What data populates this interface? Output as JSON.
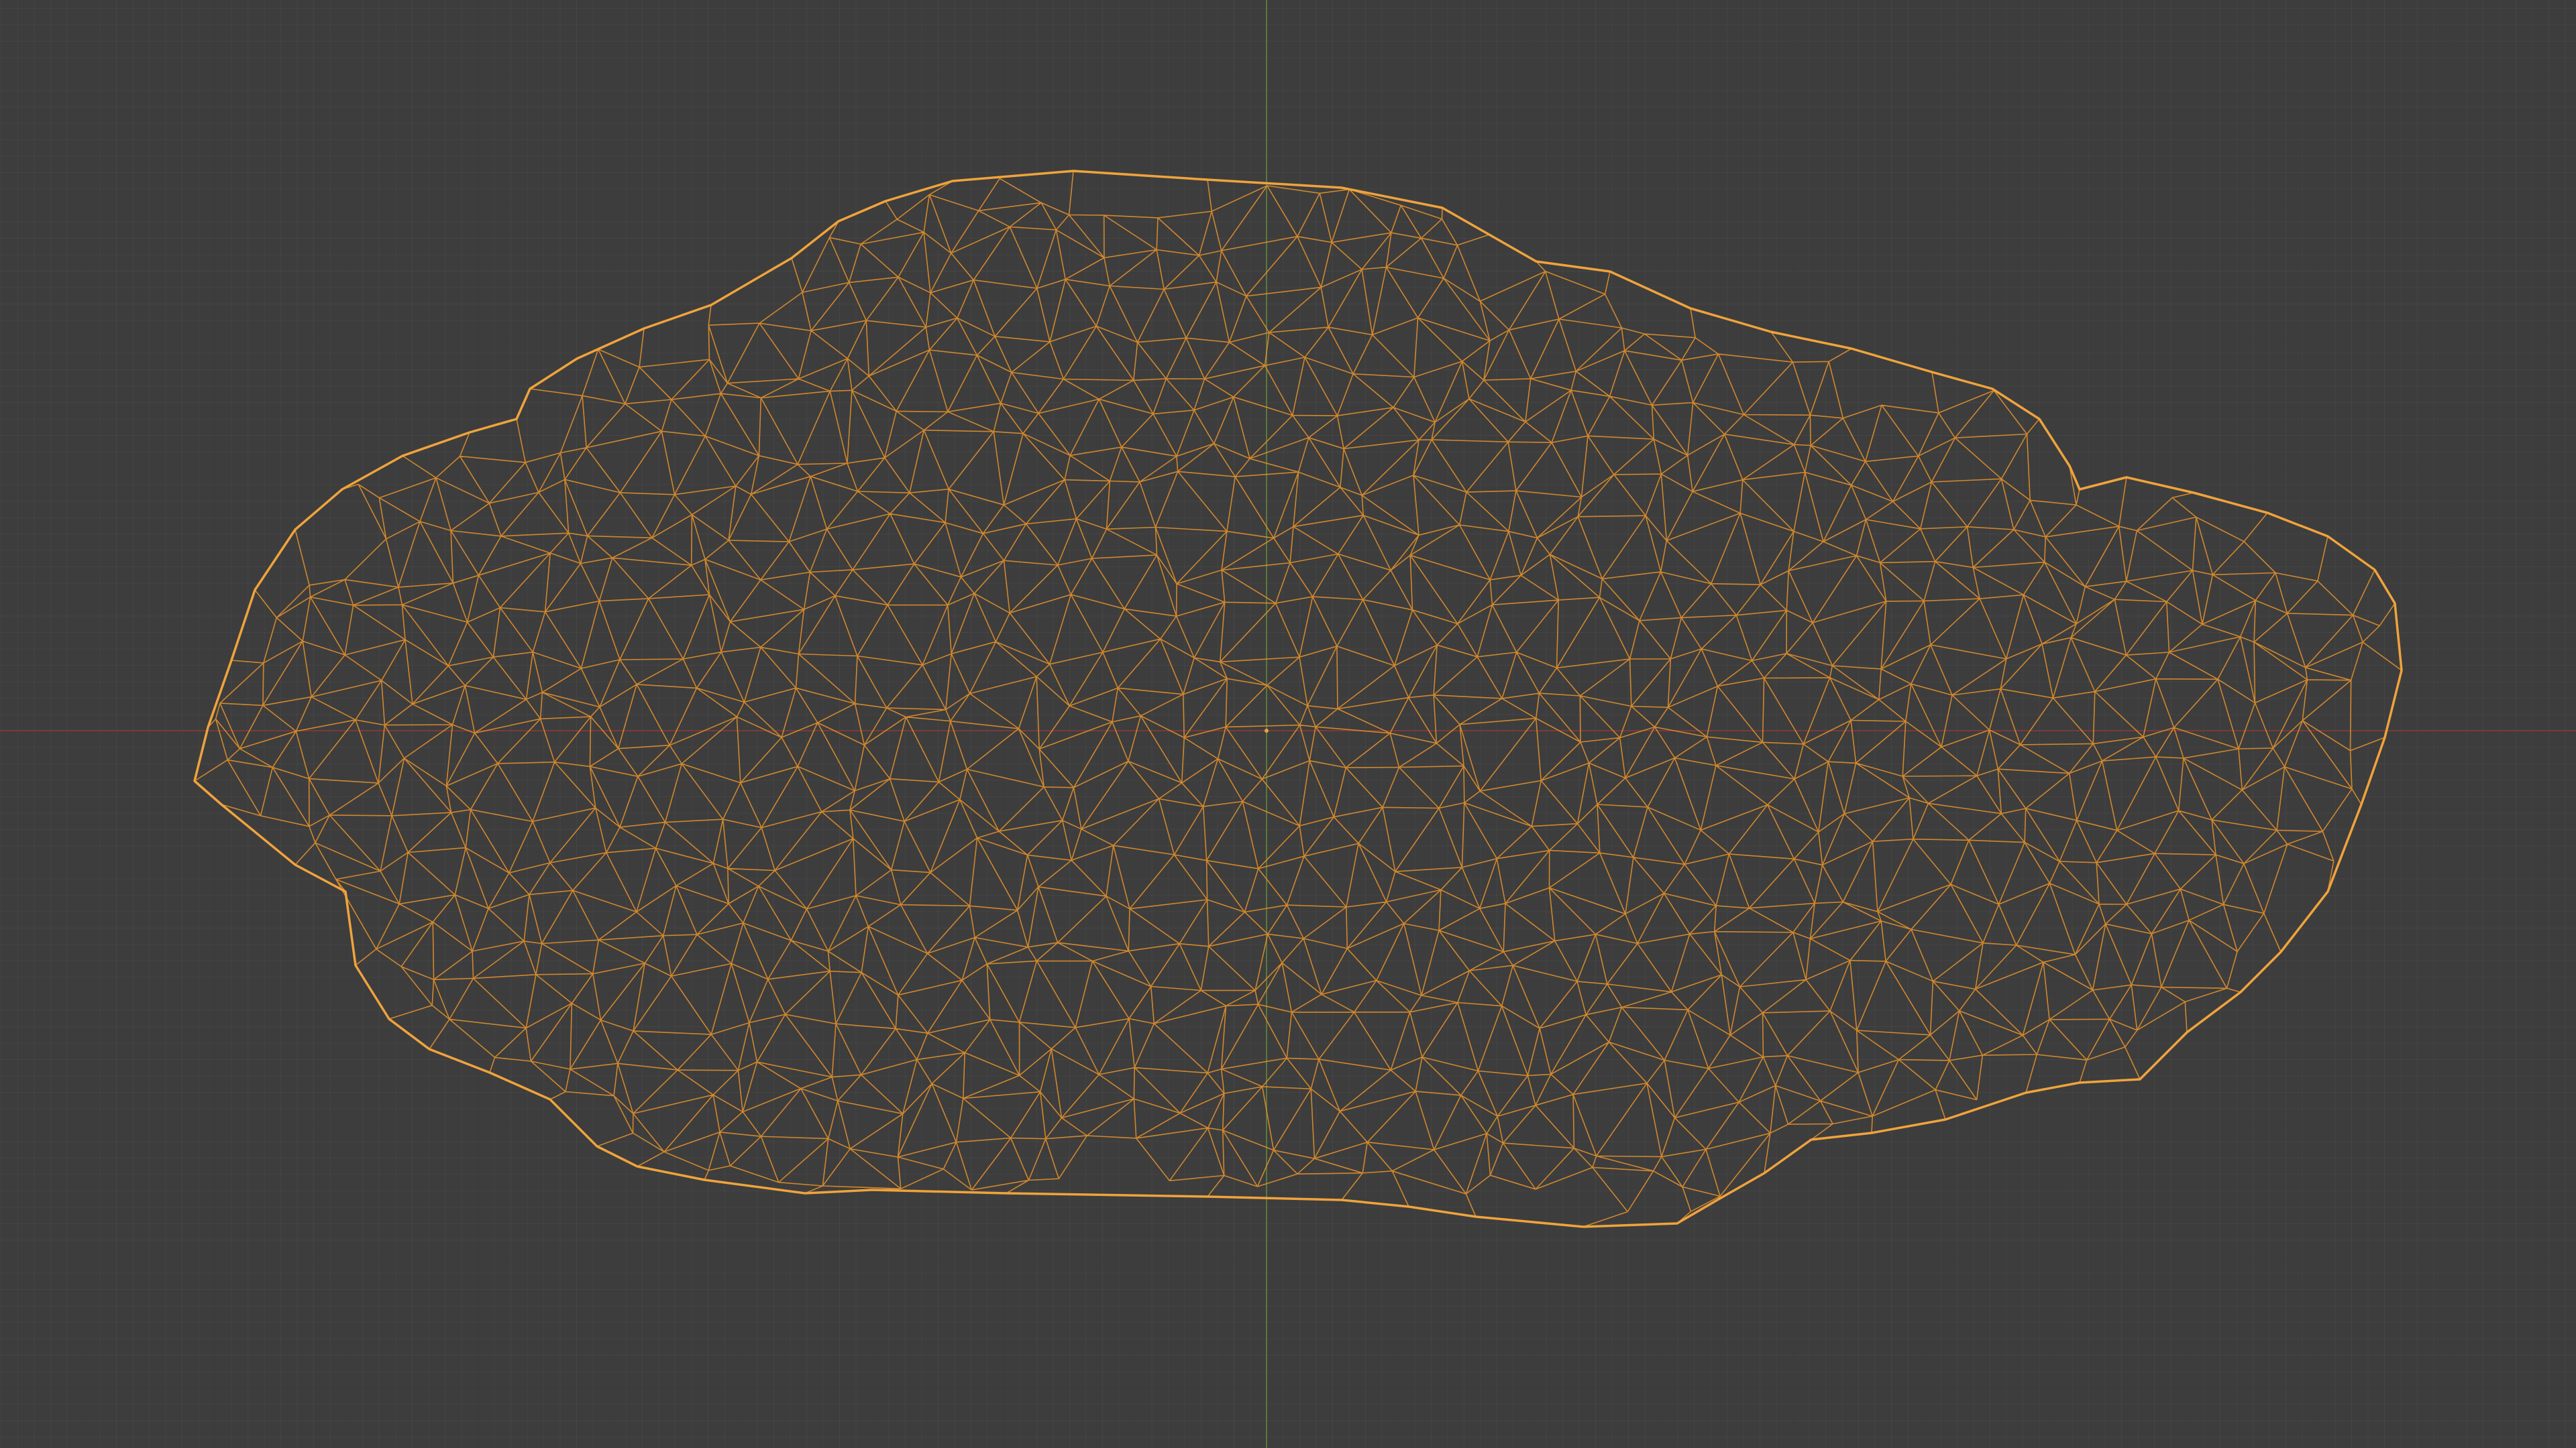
{
  "viewport": {
    "background": "#3d3d3d",
    "grid_minor": "#424242",
    "grid_major": "#363636",
    "x_axis_color": "#7a3a3a",
    "y_axis_color": "#5a7a3a",
    "wire_color": "#e08f2c",
    "wire_outline_color": "#f0a33c",
    "origin_color": "#e6a24a"
  },
  "object": {
    "icon": "wireframe-mesh-icon",
    "mode": "wireframe",
    "selected": true
  }
}
